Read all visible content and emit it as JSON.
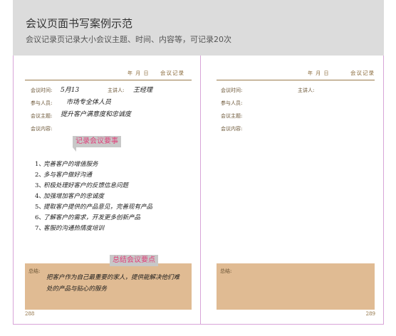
{
  "header": {
    "title": "会议页面书写案例示范",
    "subtitle": "会议记录页记录大小会议主题、时间、内容等，可记录20次"
  },
  "left_page": {
    "date_label": "年  月  日",
    "page_title": "会议记录",
    "fields": {
      "time_label": "会议时间:",
      "time_value": "5月13",
      "host_label": "主讲人:",
      "host_value": "王经理",
      "attendees_label": "参与人员:",
      "attendees_value": "市场专全体人员",
      "topic_label": "会议主题:",
      "topic_value": "提升客户满意度和忠诚度",
      "content_label": "会议内容:"
    },
    "callout_record": "记录会议要事",
    "items": [
      {
        "num": "1、",
        "text": "完善客户的增值服务"
      },
      {
        "num": "2、",
        "text": "多与客户做好沟通"
      },
      {
        "num": "3、",
        "text": "积极处理好客户的反馈信息问题"
      },
      {
        "num": "4、",
        "text": "加强增加客户的忠诚度"
      },
      {
        "num": "5、",
        "text": "提取客户提供的产品意见，完善现有产品"
      },
      {
        "num": "6、",
        "text": "了解客户的需求，开发更多创新产品"
      },
      {
        "num": "7、",
        "text": "客服的沟通热情度培训"
      }
    ],
    "callout_summary": "总结会议要点",
    "summary_label": "总结:",
    "summary_text": "把客户作为自己最重要的家人，提供能解决他们难处的产品与贴心的服务",
    "page_number": "288"
  },
  "right_page": {
    "date_label": "年  月  日",
    "page_title": "会议记录",
    "fields": {
      "time_label": "会议时间:",
      "host_label": "主讲人:",
      "attendees_label": "参与人员:",
      "topic_label": "会议主题:",
      "content_label": "会议内容:"
    },
    "summary_label": "总结:",
    "page_number": "289"
  },
  "colors": {
    "summary_fill": "#e0bb93",
    "callout_text": "#e0407a",
    "page_border": "#d8a4d8"
  }
}
